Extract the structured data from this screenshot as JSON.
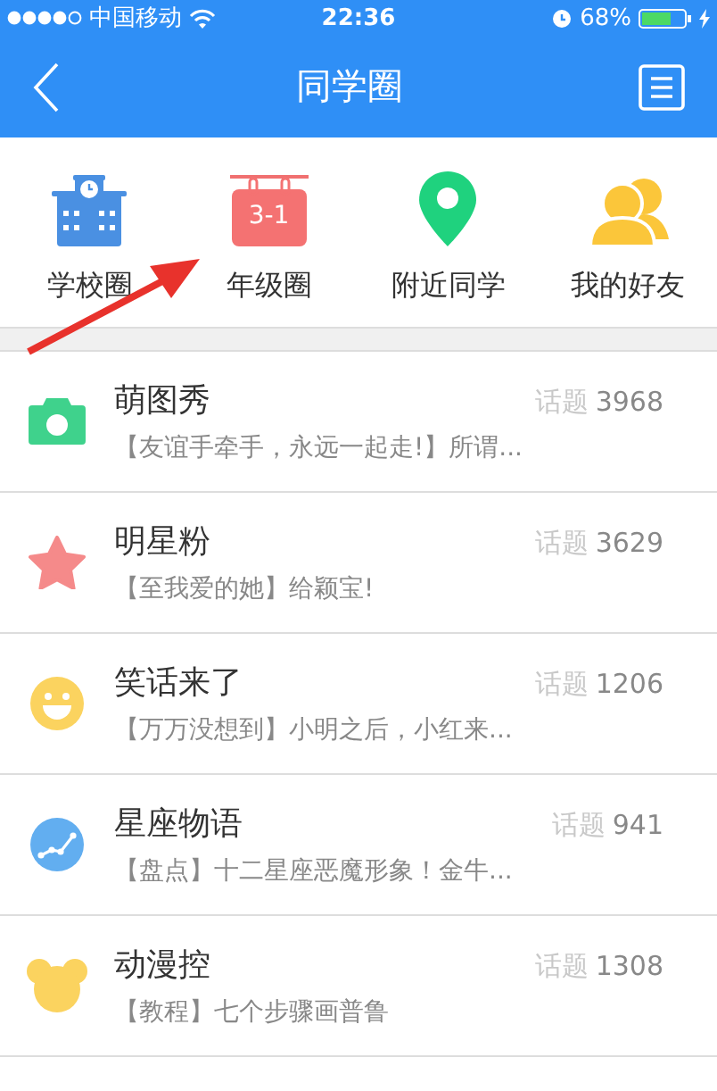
{
  "status_bar": {
    "carrier": "中国移动",
    "time": "22:36",
    "battery": "68%"
  },
  "nav": {
    "title": "同学圈"
  },
  "categories": [
    {
      "kind": "school",
      "label": "学校圈"
    },
    {
      "kind": "calendar",
      "label": "年级圈",
      "badge": "3-1"
    },
    {
      "kind": "pin",
      "label": "附近同学"
    },
    {
      "kind": "friends",
      "label": "我的好友"
    }
  ],
  "topics": [
    {
      "kind": "camera",
      "title": "萌图秀",
      "topic_label": "话题",
      "count": "3968",
      "summary": "【友谊手牵手，永远一起走!】所谓..."
    },
    {
      "kind": "star",
      "title": "明星粉",
      "topic_label": "话题",
      "count": "3629",
      "summary": "【至我爱的她】给颖宝!"
    },
    {
      "kind": "smiley",
      "title": "笑话来了",
      "topic_label": "话题",
      "count": "1206",
      "summary": "【万万没想到】小明之后，小红来..."
    },
    {
      "kind": "chart",
      "title": "星座物语",
      "topic_label": "话题",
      "count": "941",
      "summary": "【盘点】十二星座恶魔形象！金牛..."
    },
    {
      "kind": "bear",
      "title": "动漫控",
      "topic_label": "话题",
      "count": "1308",
      "summary": "【教程】七个步骤画普鲁"
    }
  ]
}
